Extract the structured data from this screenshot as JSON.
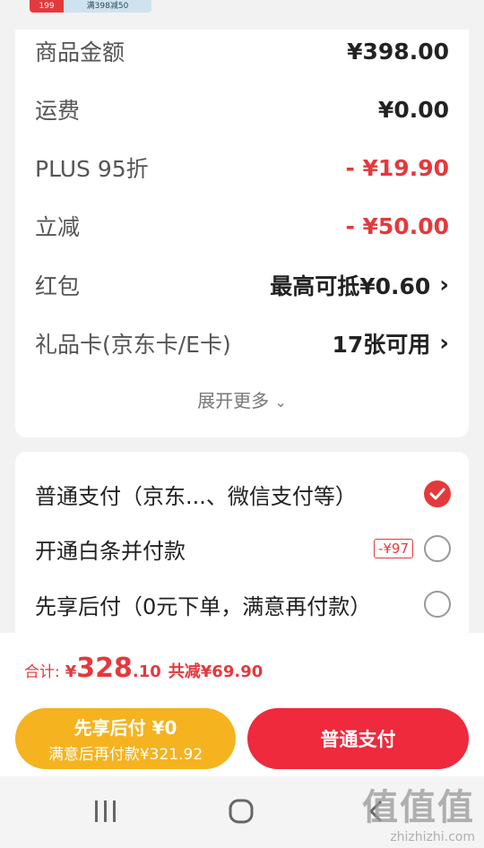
{
  "promo_thumb": {
    "left": "199",
    "right": "满398减50"
  },
  "price_detail": {
    "rows": [
      {
        "label": "商品金额",
        "value": "¥398.00"
      },
      {
        "label": "运费",
        "value": "¥0.00"
      },
      {
        "label": "PLUS 95折",
        "value": "- ¥19.90"
      },
      {
        "label": "立减",
        "value": "- ¥50.00"
      },
      {
        "label": "红包",
        "value": "最高可抵¥0.60"
      },
      {
        "label": "礼品卡(京东卡/E卡)",
        "value": "17张可用"
      }
    ],
    "expand_more": "展开更多"
  },
  "payment": {
    "options": [
      {
        "label": "普通支付（京东...、微信支付等）",
        "selected": true
      },
      {
        "label": "开通白条并付款",
        "badge": "-¥97",
        "selected": false
      },
      {
        "label": "先享后付（0元下单，满意再付款）",
        "selected": false
      }
    ]
  },
  "summary": {
    "label": "合计:",
    "yen": "¥",
    "total_int": "328",
    "total_dec": ".10",
    "saved": "共减¥69.90"
  },
  "buttons": {
    "pay_later_title": "先享后付 ¥0",
    "pay_later_sub": "满意后再付款¥321.92",
    "normal_pay": "普通支付"
  },
  "watermark": {
    "line1": "值值值",
    "line2": "zhizhizhi.com"
  },
  "colors": {
    "accent": "#e4393c",
    "orange": "#f5b320"
  }
}
